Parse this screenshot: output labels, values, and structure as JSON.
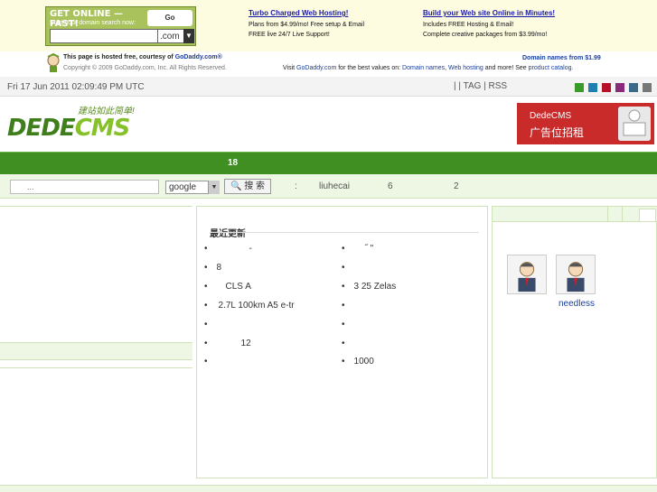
{
  "ad": {
    "gd_headline": "GET ONLINE — FAST!",
    "gd_sub": "Start your domain search now:",
    "gd_logo": "Go Daddy.com",
    "gd_tld": ".com",
    "col1": {
      "title": "Turbo Charged Web Hosting!",
      "l1": "Plans from $4.99/mo! Free setup & Email",
      "l2": "FREE live 24/7 Live Support!"
    },
    "col2": {
      "title": "Build your Web site Online in Minutes!",
      "l1": "Includes FREE Hosting & Email!",
      "l2": "Complete creative packages from $3.99/mo!"
    }
  },
  "hosting": {
    "line1_prefix": "This page is hosted free, courtesy of ",
    "line1_link": "GoDaddy.com®",
    "line2": "Copyright © 2009 GoDaddy.com, Inc. All Rights Reserved.",
    "right_link": "Domain names from $1.99",
    "visit_prefix": "Visit ",
    "visit_link": "GoDaddy.com",
    "visit_mid": " for the best values on: ",
    "link_domains": "Domain names",
    "link_hosting": "Web hosting",
    "visit_more": " and more! See ",
    "link_catalog": "product catalog."
  },
  "topbar": {
    "date": "Fri 17 Jun 2011 02:09:49 PM UTC",
    "links": "|     | TAG  | RSS",
    "swatches": [
      "#3a9b2a",
      "#1f7fb0",
      "#b8102a",
      "#8a2a7a",
      "#3a6a8a",
      "#777777"
    ]
  },
  "logo": {
    "main_a": "DEDE",
    "main_b": "CMS",
    "slogan": "建站如此简单!"
  },
  "banner": {
    "line1": "DedeCMS",
    "line2": "广告位招租"
  },
  "nav": {
    "item": "18"
  },
  "search": {
    "placeholder": "...",
    "engine": "google",
    "button": "搜 索",
    "hot_colon": ":",
    "hot1": "liuhecai",
    "hot2": "6",
    "hot3": "2"
  },
  "main": {
    "title": "最近更新",
    "left_items": [
      "-",
      "8",
      "CLS      A",
      "2.7L 100km   A5 e-tr",
      "",
      "12",
      ""
    ],
    "right_items": [
      "˝ \"",
      "",
      "3 25      Zelas",
      "",
      "",
      "",
      "1000"
    ]
  },
  "sidebar": {
    "username": "needless"
  }
}
